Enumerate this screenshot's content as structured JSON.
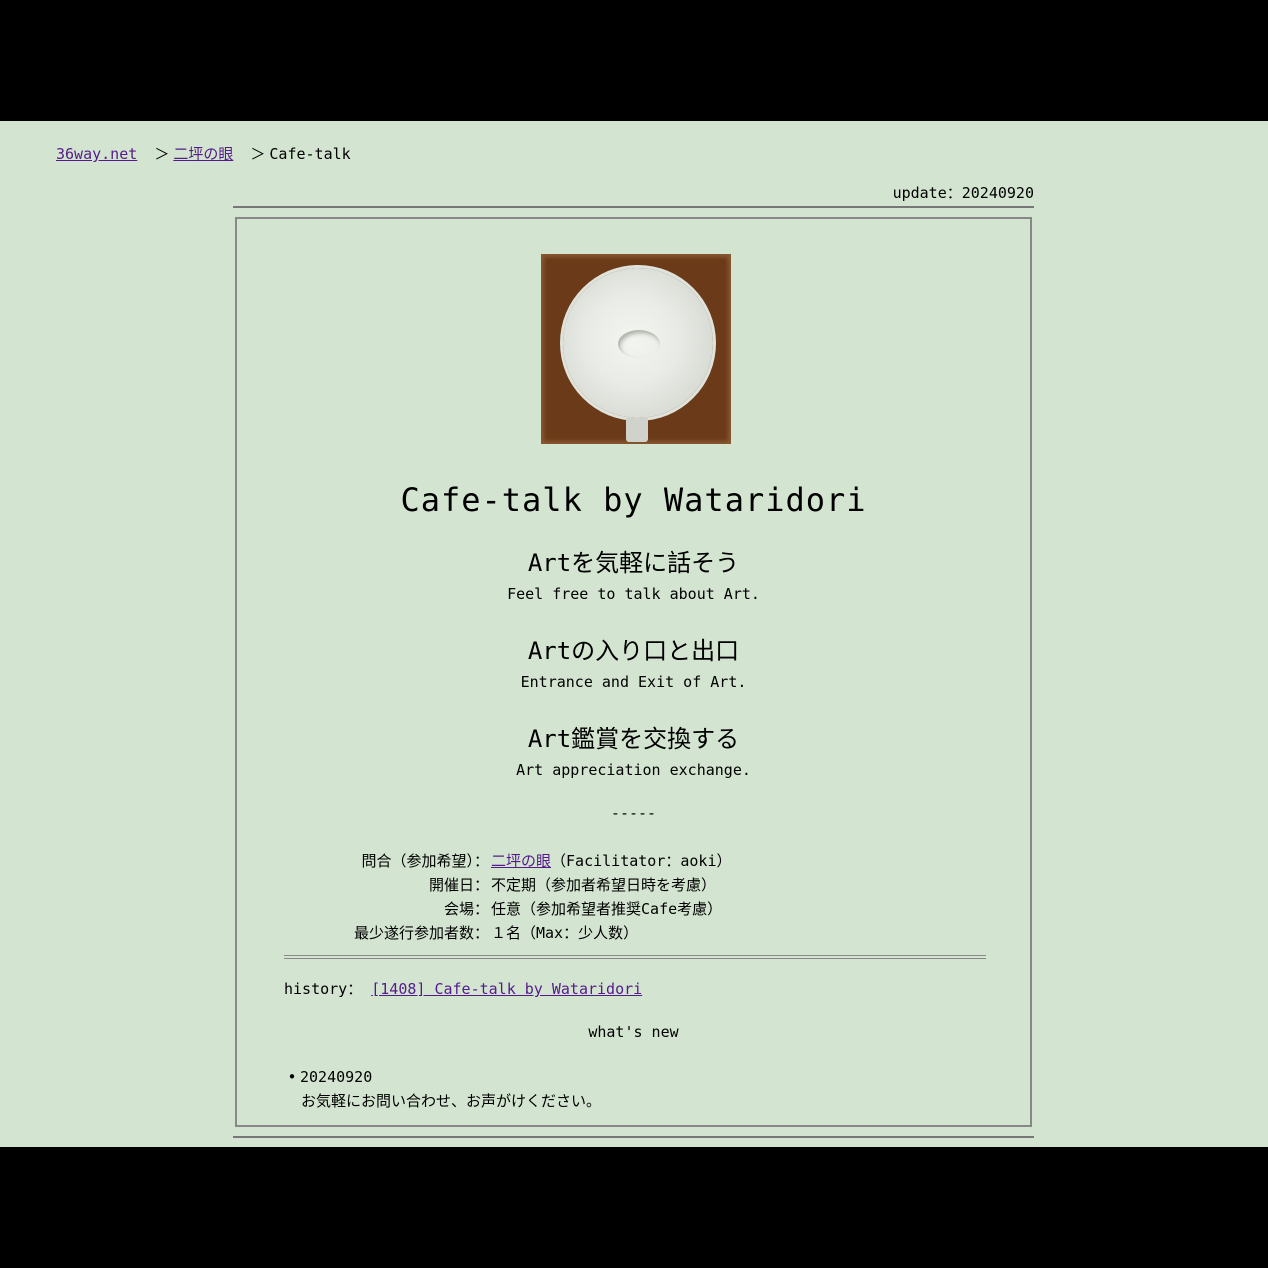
{
  "breadcrumb": {
    "home": "36way.net",
    "section": "二坪の眼",
    "sep": "＞",
    "current": "Cafe-talk"
  },
  "update": "update：20240920",
  "title": "Cafe-talk by Wataridori",
  "taglines": [
    {
      "ja": "Artを気軽に話そう",
      "en": "Feel free to talk about Art."
    },
    {
      "ja": "Artの入り口と出口",
      "en": "Entrance and Exit of Art."
    },
    {
      "ja": "Art鑑賞を交換する",
      "en": "Art appreciation exchange."
    }
  ],
  "divider": "-----",
  "info": {
    "contact_key": "問合（参加希望）：",
    "contact_link": "二坪の眼",
    "contact_rest": "（Facilitator：aoki）",
    "date_key": "開催日：",
    "date_val": "不定期（参加者希望日時を考慮）",
    "venue_key": "会場：",
    "venue_val": "任意（参加希望者推奨Cafe考慮）",
    "min_key": "最少遂行参加者数：",
    "min_val": "１名（Max：少人数）"
  },
  "history": {
    "label": "history：",
    "link": "[1408] Cafe-talk by Wataridori"
  },
  "whats_new": {
    "heading": "what's new",
    "items": [
      {
        "date": "20240920",
        "text": "お気軽にお問い合わせ、お声がけください。"
      }
    ]
  },
  "colors": {
    "page_bg": "#d3e5d1",
    "link": "#551a8b",
    "image_frame": "#6b3a18"
  },
  "icons": {
    "cup_image": "coffee-cup-eye-image"
  }
}
